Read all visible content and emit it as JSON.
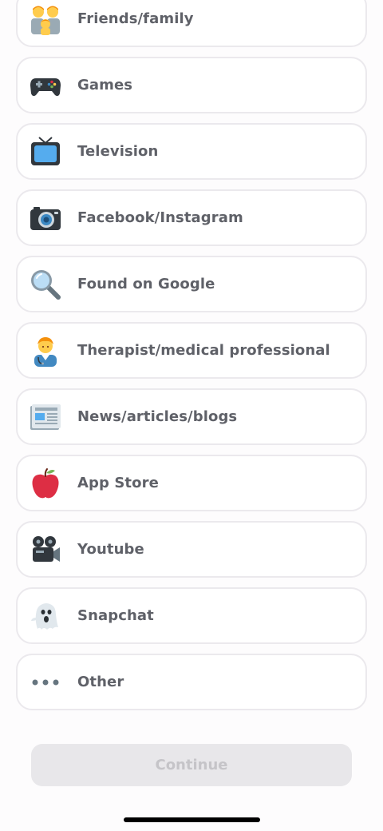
{
  "options": [
    {
      "label": "Friends/family",
      "icon": "family-icon"
    },
    {
      "label": "Games",
      "icon": "game-controller-icon"
    },
    {
      "label": "Television",
      "icon": "television-icon"
    },
    {
      "label": "Facebook/Instagram",
      "icon": "camera-icon"
    },
    {
      "label": "Found on Google",
      "icon": "magnifying-glass-icon"
    },
    {
      "label": "Therapist/medical professional",
      "icon": "health-worker-icon"
    },
    {
      "label": "News/articles/blogs",
      "icon": "newspaper-icon"
    },
    {
      "label": "App Store",
      "icon": "red-apple-icon"
    },
    {
      "label": "Youtube",
      "icon": "movie-camera-icon"
    },
    {
      "label": "Snapchat",
      "icon": "ghost-icon"
    },
    {
      "label": "Other",
      "icon": "ellipsis-icon"
    }
  ],
  "continue_label": "Continue",
  "colors": {
    "background": "#fdfcfd",
    "card_border": "#ebe9ed",
    "label": "#5f6168",
    "button_disabled_bg": "#e8e7ea",
    "button_disabled_text": "#c5c4c8"
  }
}
